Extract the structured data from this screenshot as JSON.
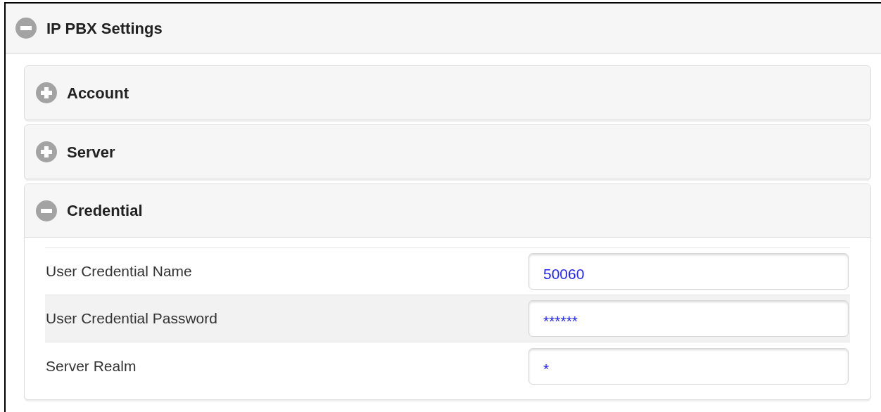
{
  "panel": {
    "title": "IP PBX Settings",
    "expanded": true
  },
  "sections": [
    {
      "title": "Account",
      "expanded": false
    },
    {
      "title": "Server",
      "expanded": false
    },
    {
      "title": "Credential",
      "expanded": true,
      "fields": [
        {
          "label": "User Credential Name",
          "value": "50060"
        },
        {
          "label": "User Credential Password",
          "value": "******"
        },
        {
          "label": "Server Realm",
          "value": "*"
        }
      ]
    }
  ]
}
